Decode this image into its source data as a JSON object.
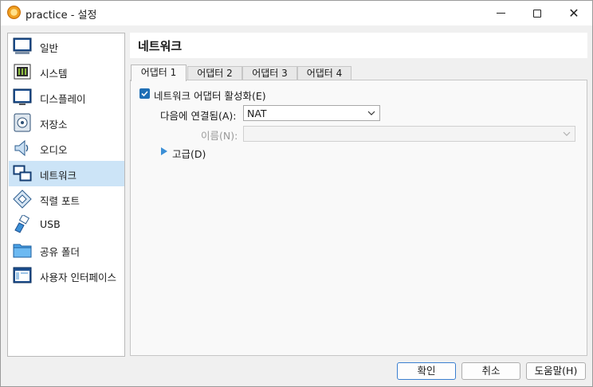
{
  "window": {
    "title": "practice - 설정"
  },
  "sidebar": {
    "items": [
      {
        "label": "일반",
        "icon": "general-icon"
      },
      {
        "label": "시스템",
        "icon": "system-icon"
      },
      {
        "label": "디스플레이",
        "icon": "display-icon"
      },
      {
        "label": "저장소",
        "icon": "storage-icon"
      },
      {
        "label": "오디오",
        "icon": "audio-icon"
      },
      {
        "label": "네트워크",
        "icon": "network-icon",
        "selected": true
      },
      {
        "label": "직렬 포트",
        "icon": "serial-port-icon"
      },
      {
        "label": "USB",
        "icon": "usb-icon"
      },
      {
        "label": "공유 폴더",
        "icon": "shared-folder-icon"
      },
      {
        "label": "사용자 인터페이스",
        "icon": "user-interface-icon"
      }
    ]
  },
  "main": {
    "title": "네트워크",
    "tabs": [
      {
        "label": "어댑터 1",
        "active": true
      },
      {
        "label": "어댑터 2"
      },
      {
        "label": "어댑터 3"
      },
      {
        "label": "어댑터 4"
      }
    ],
    "enable_adapter": {
      "label": "네트워크 어댑터 활성화(E)",
      "checked": true
    },
    "attached_to": {
      "label": "다음에 연결됨(A):",
      "value": "NAT"
    },
    "name": {
      "label": "이름(N):",
      "value": ""
    },
    "advanced": {
      "label": "고급(D)"
    }
  },
  "buttons": {
    "ok": "확인",
    "cancel": "취소",
    "help": "도움말(H)"
  },
  "colors": {
    "accent": "#1f6fb5",
    "selection": "#cce4f7"
  }
}
